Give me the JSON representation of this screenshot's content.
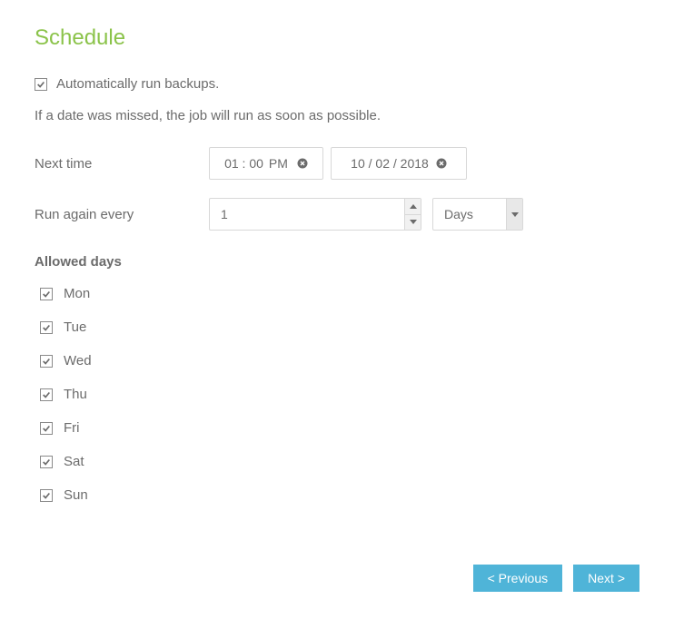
{
  "title": "Schedule",
  "auto_run": {
    "checked": true,
    "label": "Automatically run backups."
  },
  "info_text": "If a date was missed, the job will run as soon as possible.",
  "next_time": {
    "label": "Next time",
    "time": "01 : 00",
    "ampm": "PM",
    "date": "10 / 02 / 2018"
  },
  "run_again": {
    "label": "Run again every",
    "value": "1",
    "unit": "Days"
  },
  "allowed_days": {
    "title": "Allowed days",
    "days": [
      {
        "label": "Mon",
        "checked": true
      },
      {
        "label": "Tue",
        "checked": true
      },
      {
        "label": "Wed",
        "checked": true
      },
      {
        "label": "Thu",
        "checked": true
      },
      {
        "label": "Fri",
        "checked": true
      },
      {
        "label": "Sat",
        "checked": true
      },
      {
        "label": "Sun",
        "checked": true
      }
    ]
  },
  "buttons": {
    "previous": "< Previous",
    "next": "Next >"
  }
}
